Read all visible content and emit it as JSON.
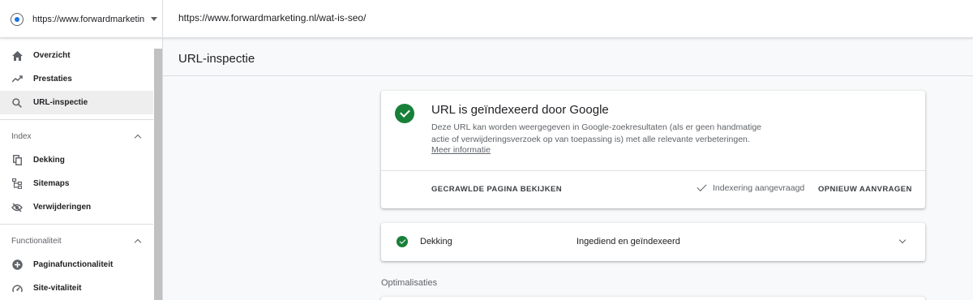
{
  "header": {
    "property": "https://www.forwardmarketing.nl/",
    "property_display": "https://www.forwardmarketin...",
    "inspected_url": "https://www.forwardmarketing.nl/wat-is-seo/"
  },
  "sidebar": {
    "top_items": [
      {
        "label": "Overzicht",
        "icon": "home-icon"
      },
      {
        "label": "Prestaties",
        "icon": "trending-up-icon"
      },
      {
        "label": "URL-inspectie",
        "icon": "search-icon",
        "active": true
      }
    ],
    "sections": [
      {
        "title": "Index",
        "items": [
          {
            "label": "Dekking",
            "icon": "copy-icon"
          },
          {
            "label": "Sitemaps",
            "icon": "sitemap-icon"
          },
          {
            "label": "Verwijderingen",
            "icon": "eye-off-icon"
          }
        ]
      },
      {
        "title": "Functionaliteit",
        "items": [
          {
            "label": "Paginafunctionaliteit",
            "icon": "plus-circle-icon"
          },
          {
            "label": "Site-vitaliteit",
            "icon": "speedometer-icon"
          }
        ]
      }
    ]
  },
  "main": {
    "title": "URL-inspectie",
    "status_card": {
      "title": "URL is geïndexeerd door Google",
      "description": "Deze URL kan worden weergegeven in Google-zoekresultaten (als er geen handmatige actie of verwijderingsverzoek op van toepassing is) met alle relevante verbeteringen.",
      "learn_more": "Meer informatie",
      "view_crawled_button": "GECRAWLDE PAGINA BEKIJKEN",
      "request_status": "Indexering aangevraagd",
      "request_again_button": "OPNIEUW AANVRAGEN",
      "status_color": "#188038"
    },
    "coverage": {
      "label": "Dekking",
      "value": "Ingediend en geïndexeerd"
    },
    "optimizations_heading": "Optimalisaties"
  }
}
